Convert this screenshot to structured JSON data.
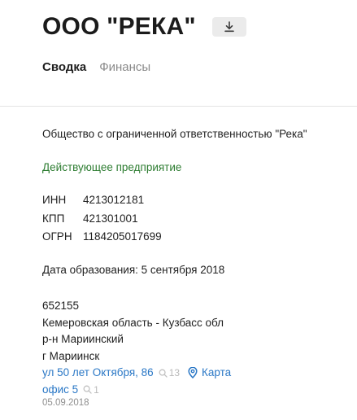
{
  "company": {
    "title": "ООО \"РЕКА\"",
    "download_icon": "download-icon"
  },
  "tabs": [
    {
      "label": "Сводка",
      "active": true
    },
    {
      "label": "Финансы",
      "active": false
    }
  ],
  "summary": {
    "full_name": "Общество с ограниченной ответственностью \"Река\"",
    "status": "Действующее предприятие",
    "status_color": "#2e7d32",
    "codes": [
      {
        "label": "ИНН",
        "value": "4213012181"
      },
      {
        "label": "КПП",
        "value": "421301001"
      },
      {
        "label": "ОГРН",
        "value": "1184205017699"
      }
    ],
    "founded": "Дата образования: 5 сентября 2018",
    "address": {
      "postcode": "652155",
      "region": "Кемеровская область - Кузбасс обл",
      "district": "р-н Мариинский",
      "city": "г Мариинск",
      "street_link": "ул 50 лет Октября, 86",
      "street_search_count": "13",
      "map_label": "Карта",
      "office_link": "офис 5",
      "office_search_count": "1"
    },
    "date": "05.09.2018"
  },
  "colors": {
    "link": "#2b78c6",
    "muted": "#8a8a8a"
  }
}
